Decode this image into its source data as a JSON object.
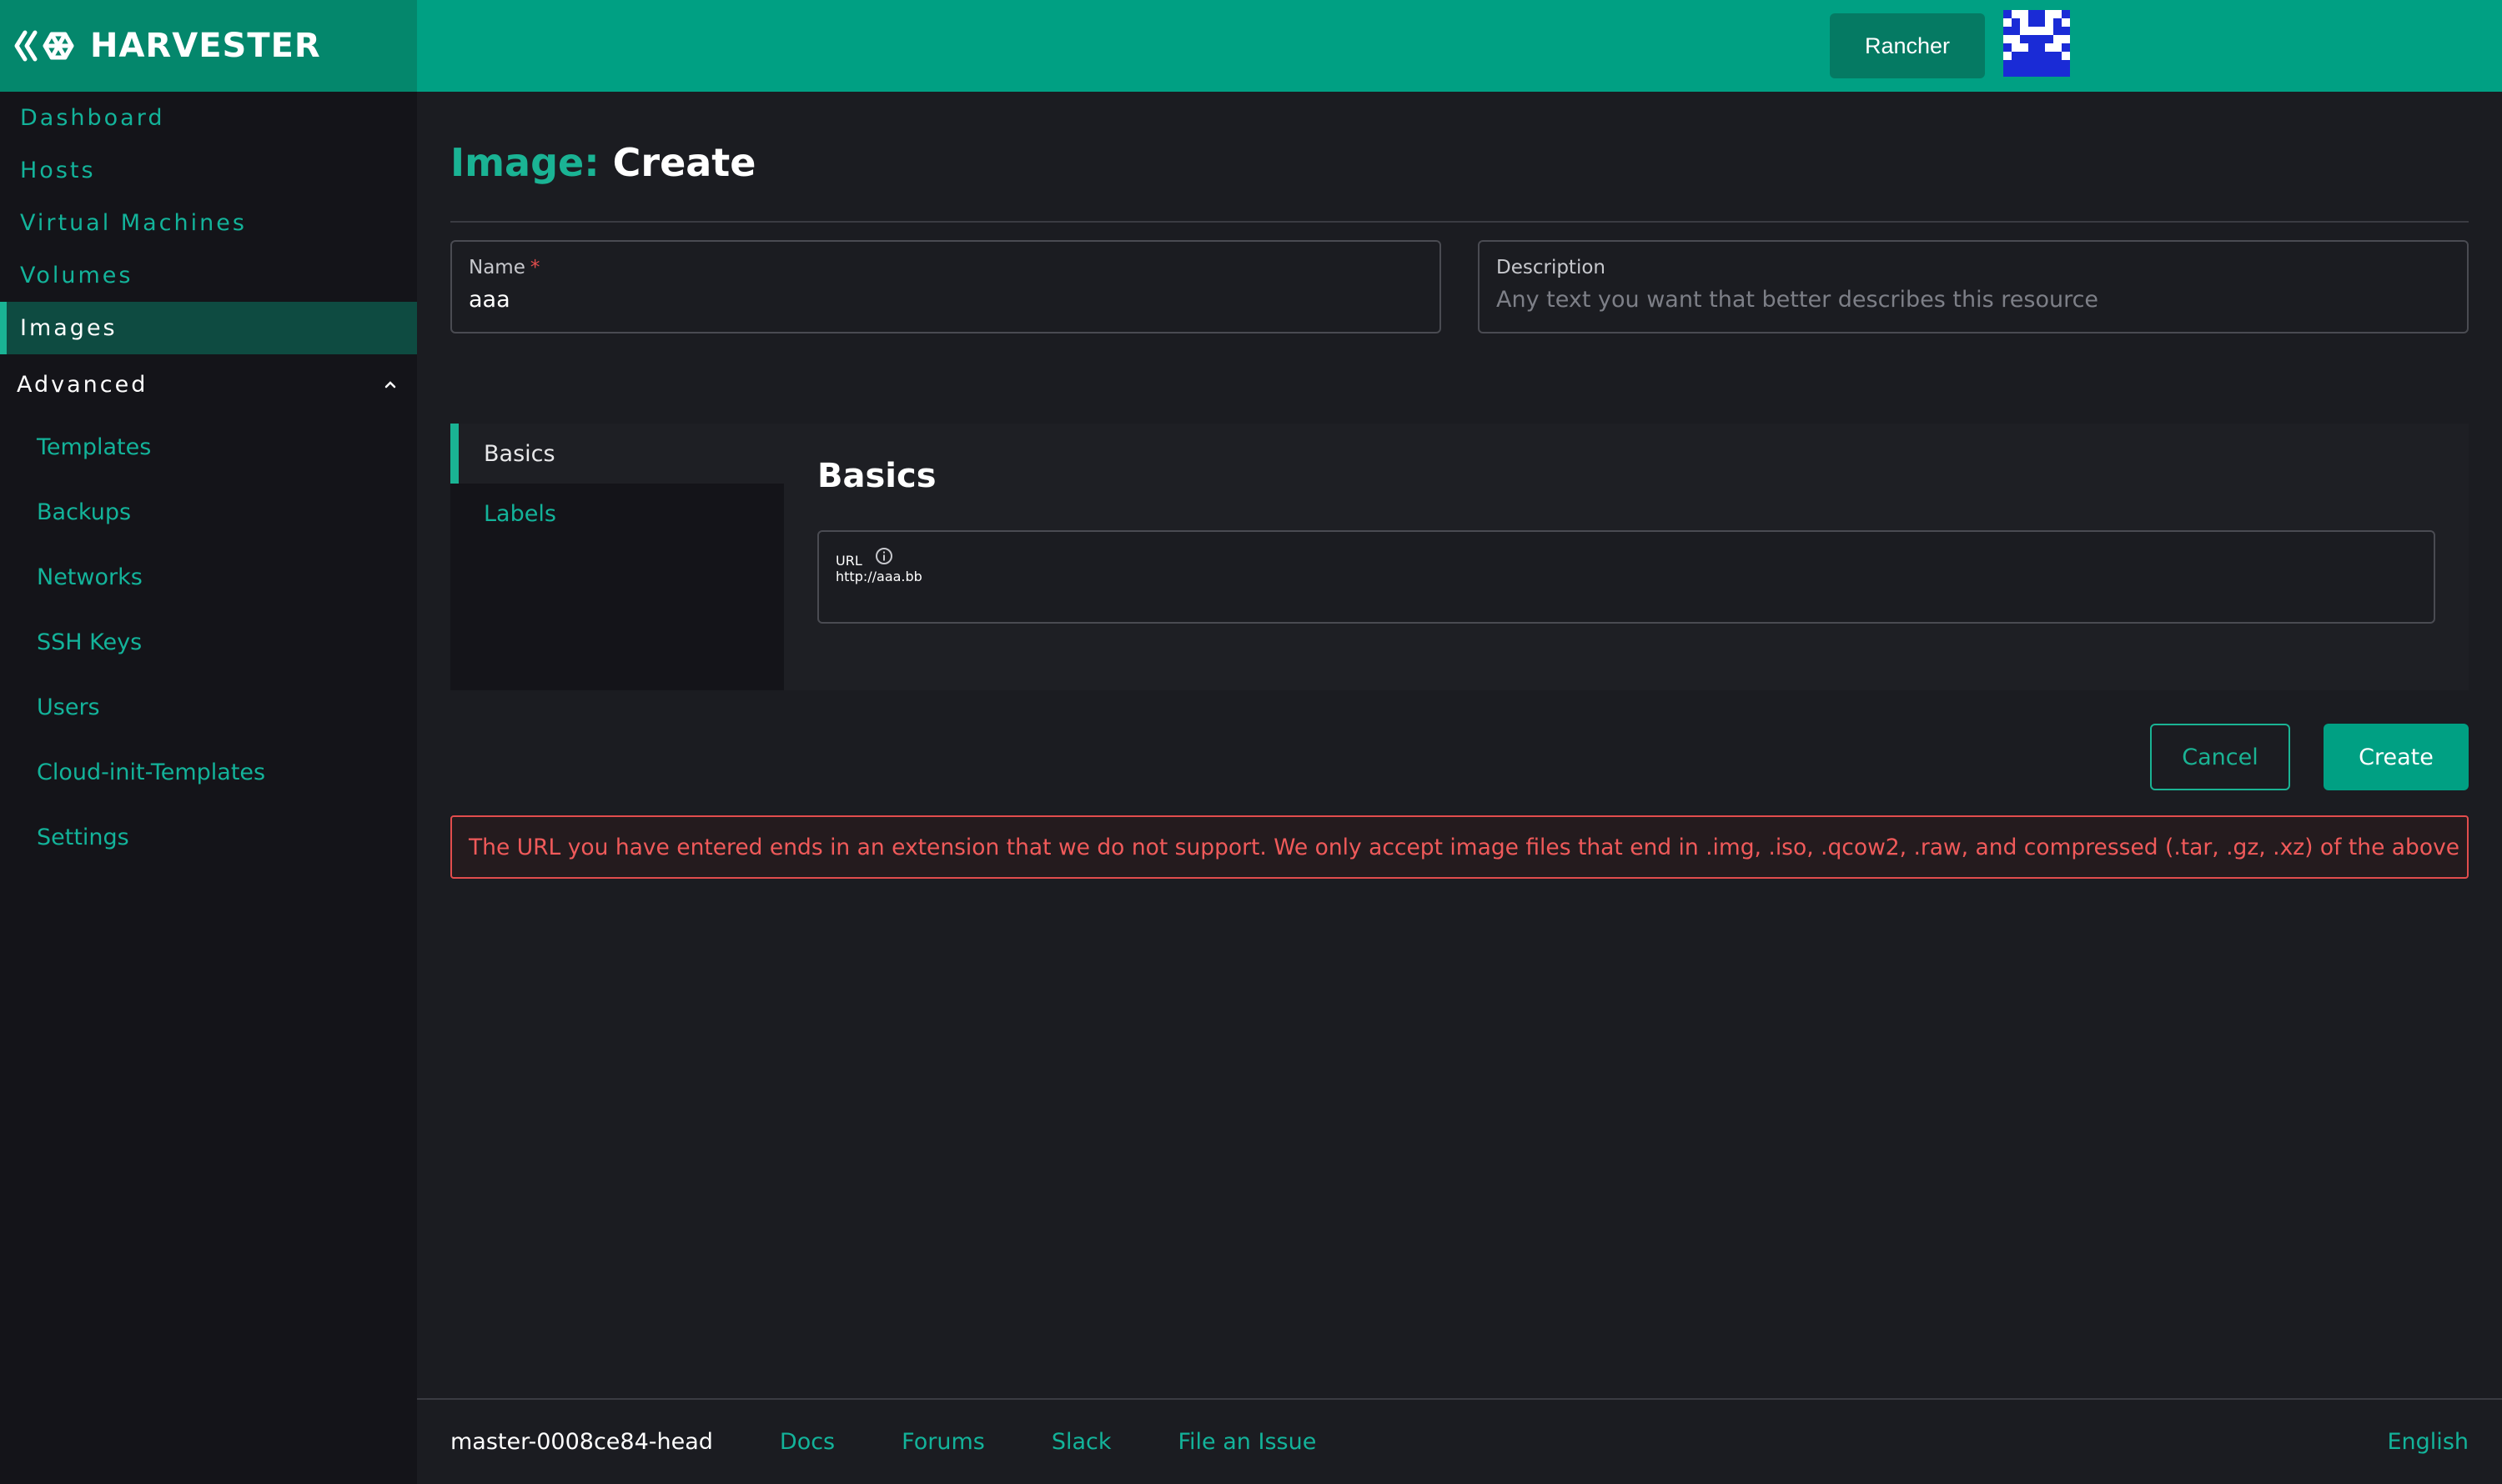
{
  "brand": {
    "name": "HARVESTER"
  },
  "sidebar": {
    "items": [
      {
        "label": "Dashboard"
      },
      {
        "label": "Hosts"
      },
      {
        "label": "Virtual Machines"
      },
      {
        "label": "Volumes"
      },
      {
        "label": "Images"
      }
    ],
    "active": "Images",
    "group": {
      "label": "Advanced",
      "items": [
        {
          "label": "Templates"
        },
        {
          "label": "Backups"
        },
        {
          "label": "Networks"
        },
        {
          "label": "SSH Keys"
        },
        {
          "label": "Users"
        },
        {
          "label": "Cloud-init-Templates"
        },
        {
          "label": "Settings"
        }
      ]
    }
  },
  "topbar": {
    "rancher_label": "Rancher"
  },
  "page": {
    "title_kind": "Image:",
    "title_action": "Create"
  },
  "form": {
    "name": {
      "label": "Name",
      "required_mark": "*",
      "value": "aaa"
    },
    "description": {
      "label": "Description",
      "placeholder": "Any text you want that better describes this resource"
    },
    "tabs": [
      {
        "label": "Basics"
      },
      {
        "label": "Labels"
      }
    ],
    "active_tab": "Basics",
    "section_title": "Basics",
    "url": {
      "label": "URL",
      "value": "http://aaa.bb"
    },
    "cancel_label": "Cancel",
    "create_label": "Create",
    "error": "The URL you have entered ends in an extension that we do not support. We only accept image files that end in .img, .iso, .qcow2, .raw, and compressed (.tar, .gz, .xz) of the above formats."
  },
  "footer": {
    "version": "master-0008ce84-head",
    "links": [
      {
        "label": "Docs"
      },
      {
        "label": "Forums"
      },
      {
        "label": "Slack"
      },
      {
        "label": "File an Issue"
      }
    ],
    "language": "English"
  },
  "colors": {
    "accent": "#1ab394",
    "topbar": "#00a083",
    "error": "#e24d4d"
  }
}
